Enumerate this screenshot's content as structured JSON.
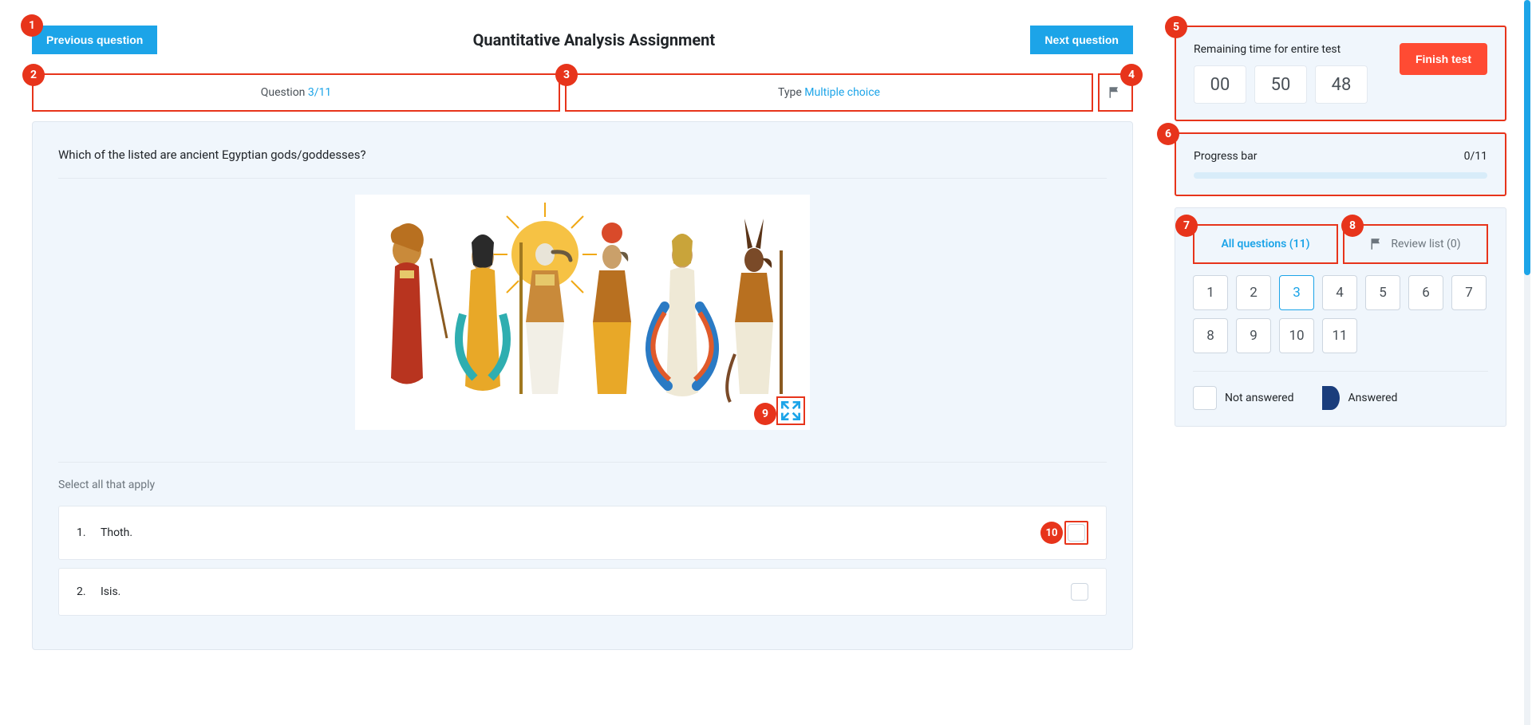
{
  "header": {
    "prev_label": "Previous question",
    "title": "Quantitative Analysis Assignment",
    "next_label": "Next question"
  },
  "info": {
    "question_label": "Question ",
    "question_value": "3/11",
    "type_label": "Type ",
    "type_value": "Multiple choice"
  },
  "badges": {
    "b1": "1",
    "b2": "2",
    "b3": "3",
    "b4": "4",
    "b5": "5",
    "b6": "6",
    "b7": "7",
    "b8": "8",
    "b9": "9",
    "b10": "10"
  },
  "question": {
    "text": "Which of the listed are ancient Egyptian gods/goddesses?",
    "instruction": "Select all that apply",
    "options": [
      {
        "num": "1.",
        "label": "Thoth."
      },
      {
        "num": "2.",
        "label": "Isis."
      }
    ]
  },
  "timer": {
    "label": "Remaining time for entire test",
    "hh": "00",
    "mm": "50",
    "ss": "48",
    "finish_label": "Finish test"
  },
  "progress": {
    "label": "Progress bar",
    "value": "0/11"
  },
  "tabs": {
    "all_label": "All questions (11)",
    "review_label": "Review list (0)"
  },
  "qnums": [
    "1",
    "2",
    "3",
    "4",
    "5",
    "6",
    "7",
    "8",
    "9",
    "10",
    "11"
  ],
  "current_q": "3",
  "legend": {
    "not_answered": "Not answered",
    "answered": "Answered"
  }
}
